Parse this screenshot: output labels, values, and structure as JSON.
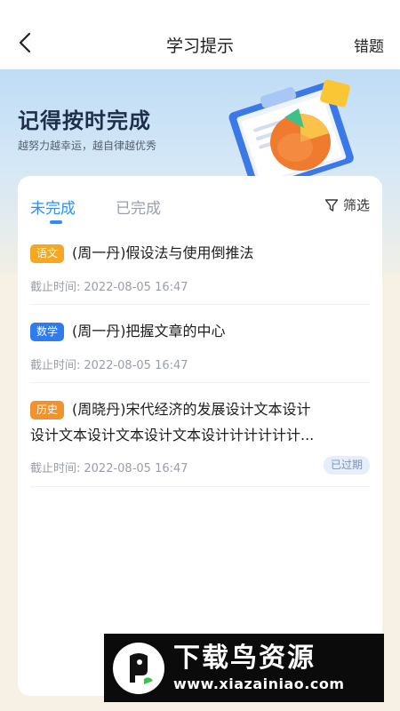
{
  "header": {
    "title": "学习提示",
    "right_action": "错题"
  },
  "banner": {
    "title": "记得按时完成",
    "subtitle": "越努力越幸运，越自律越优秀"
  },
  "tabs": [
    {
      "label": "未完成",
      "active": true
    },
    {
      "label": "已完成",
      "active": false
    }
  ],
  "filter": {
    "label": "筛选",
    "icon": "filter-icon"
  },
  "tasks": [
    {
      "subject": "语文",
      "subject_color": "#f5a623",
      "title": "(周一丹)假设法与使用倒推法",
      "deadline_label": "截止时间:",
      "deadline": "2022-08-05 16:47",
      "status": ""
    },
    {
      "subject": "数学",
      "subject_color": "#2f7cf0",
      "title": "(周一丹)把握文章的中心",
      "deadline_label": "截止时间:",
      "deadline": "2022-08-05 16:47",
      "status": ""
    },
    {
      "subject": "历史",
      "subject_color": "#f0922e",
      "title_line1": "(周晓丹)宋代经济的发展设计文本设计",
      "title_line2": "设计文本设计文本设计文本设计计计计计计...",
      "deadline_label": "截止时间:",
      "deadline": "2022-08-05 16:47",
      "status": "已过期"
    }
  ],
  "watermark": {
    "name": "下载鸟资源",
    "url": "www.xiazainiao.com"
  },
  "colors": {
    "accent": "#2f8df3",
    "background": "#f6f1e4"
  }
}
